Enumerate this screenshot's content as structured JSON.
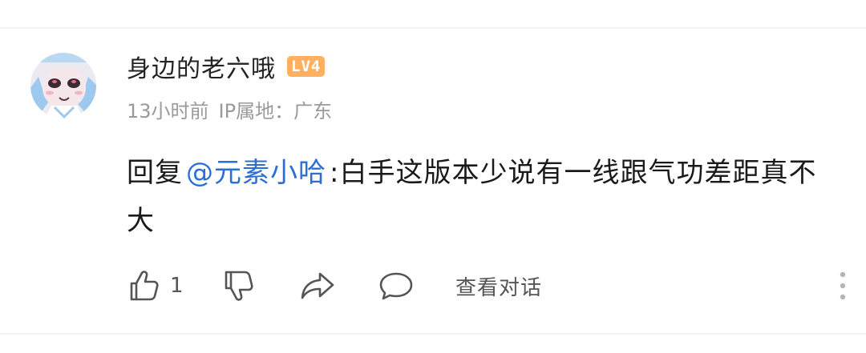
{
  "comment": {
    "author": {
      "name": "身边的老六哦",
      "level_badge": "LV4",
      "avatar_icon": "anime-avatar-icon"
    },
    "meta": {
      "time": "13小时前",
      "ip_location": "IP属地：广东"
    },
    "body": {
      "reply_prefix": "回复",
      "mention": "@元素小哈",
      "text": ":白手这版本少说有一线跟气功差距真不大"
    },
    "actions": {
      "like_icon": "thumbs-up-icon",
      "like_count": "1",
      "dislike_icon": "thumbs-down-icon",
      "share_icon": "share-icon",
      "reply_icon": "comment-bubble-icon",
      "view_conversation": "查看对话",
      "more_icon": "more-vertical-icon"
    }
  },
  "colors": {
    "mention": "#2b6fd6",
    "level_badge": "#ffb060",
    "meta_text": "#9a9a9a"
  }
}
